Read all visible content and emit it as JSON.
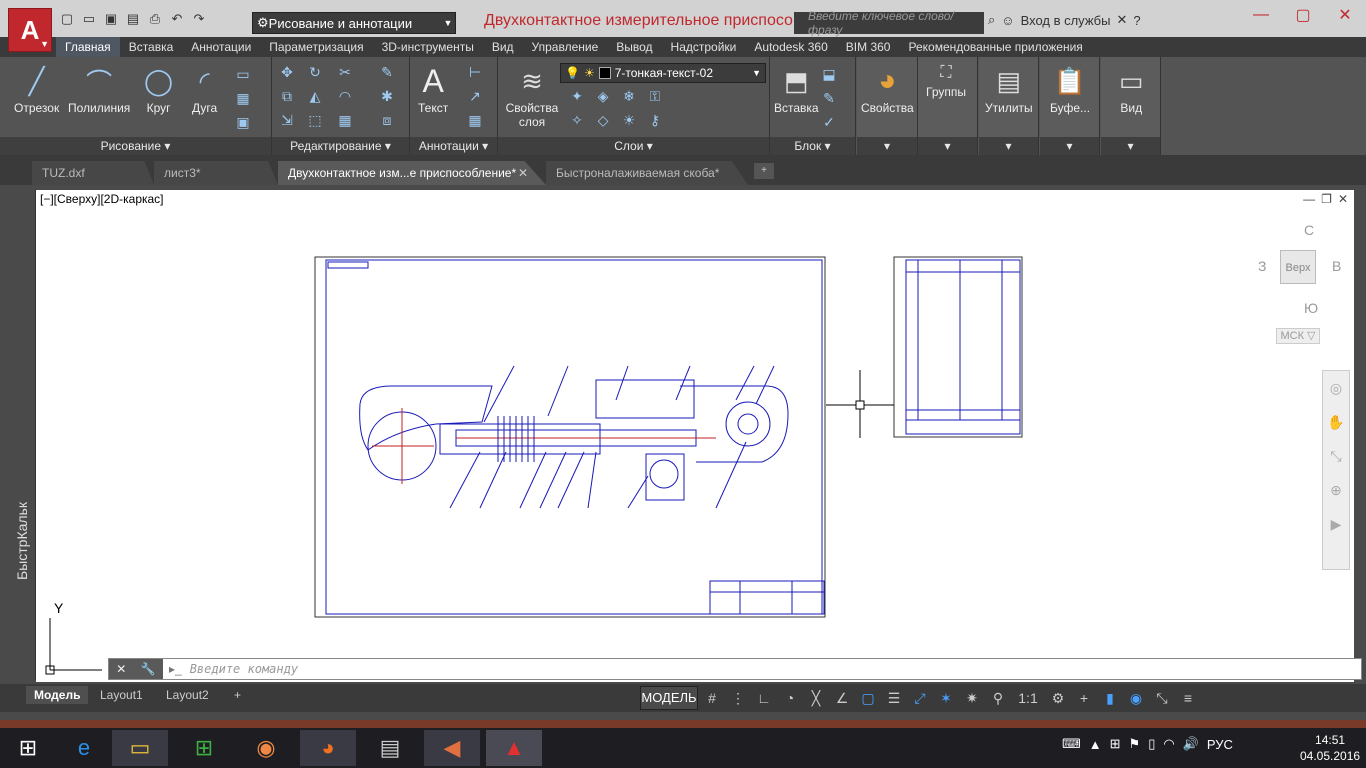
{
  "app": {
    "title": "Двухконтактное измерительное приспосо...",
    "workspace": "Рисование и аннотации",
    "search_placeholder": "Введите ключевое слово/фразу",
    "signin": "Вход в службы"
  },
  "ribbon_tabs": [
    "Главная",
    "Вставка",
    "Аннотации",
    "Параметризация",
    "3D-инструменты",
    "Вид",
    "Управление",
    "Вывод",
    "Надстройки",
    "Autodesk 360",
    "BIM 360",
    "Рекомендованные приложения"
  ],
  "draw": {
    "line": "Отрезок",
    "polyline": "Полилиния",
    "circle": "Круг",
    "arc": "Дуга",
    "title": "Рисование"
  },
  "modify": {
    "title": "Редактирование"
  },
  "annotation": {
    "text": "Текст",
    "title": "Аннотации"
  },
  "layers": {
    "props": "Свойства слоя",
    "current": "7-тонкая-текст-02",
    "title": "Слои"
  },
  "block": {
    "insert": "Вставка",
    "title": "Блок"
  },
  "extra": {
    "props": "Свойства",
    "groups": "Группы",
    "utils": "Утилиты",
    "clip": "Буфе...",
    "view": "Вид"
  },
  "doc_tabs": [
    "TUZ.dxf",
    "лист3*",
    "Двухконтактное изм...е приспособление*",
    "Быстроналаживаемая скоба*"
  ],
  "viewport_label": "[−][Сверху][2D-каркас]",
  "viewcube": {
    "n": "С",
    "s": "Ю",
    "w": "З",
    "e": "В",
    "face": "Верх",
    "ucs": "МСК"
  },
  "side_palette": "БыстрКальк",
  "ucs_y": "Y",
  "command_placeholder": "Введите команду",
  "layouts": [
    "Модель",
    "Layout1",
    "Layout2"
  ],
  "status": {
    "model": "МОДЕЛЬ",
    "scale": "1:1"
  },
  "tray": {
    "lang": "РУС",
    "time": "14:51",
    "date": "04.05.2016"
  }
}
